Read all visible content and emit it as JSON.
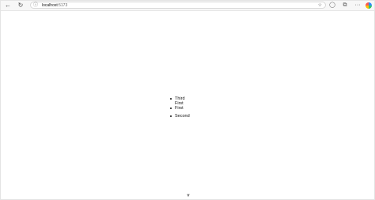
{
  "browser": {
    "url_host": "localhost",
    "url_port": ":5173"
  },
  "list": {
    "items": [
      "Third",
      "First",
      "First",
      "Second"
    ]
  },
  "icons": {
    "back": "back-arrow-icon",
    "refresh": "refresh-icon",
    "site_info": "info-icon",
    "favorite": "star-icon",
    "copilot": "copilot-icon",
    "extensions": "extensions-icon",
    "menu": "more-icon",
    "scroll": "scroll-down-icon"
  }
}
